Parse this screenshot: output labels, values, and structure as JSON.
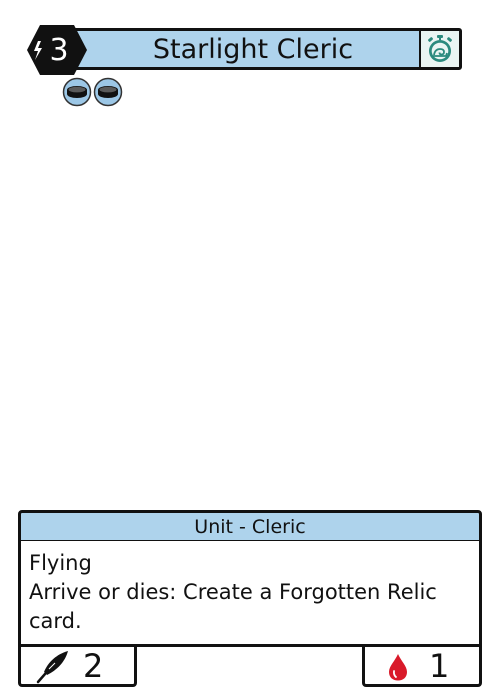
{
  "card": {
    "name": "Starlight Cleric",
    "cost": "3",
    "type_line": "Unit - Cleric",
    "rules_text": [
      "Flying",
      "Arrive or dies: Create a Forgotten Relic",
      "card."
    ],
    "attack": "2",
    "health": "1",
    "token_count": 2,
    "icons": {
      "cost": "lightning-bolt-icon",
      "speed": "stopwatch-snail-icon",
      "token": "disc-token-icon",
      "attack": "feather-quill-icon",
      "health": "blood-drop-icon"
    },
    "colors": {
      "bar": "#aed3ec",
      "hex": "#111111",
      "timer_icon": "#2b8a7e",
      "token": "#9cc7e6",
      "blood": "#d91a2a"
    }
  }
}
